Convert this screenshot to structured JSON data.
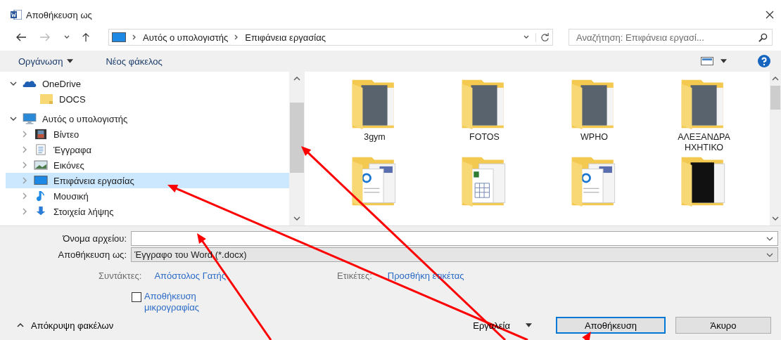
{
  "window": {
    "title": "Αποθήκευση ως"
  },
  "address": {
    "path": [
      "Αυτός ο υπολογιστής",
      "Επιφάνεια εργασίας"
    ]
  },
  "search": {
    "placeholder": "Αναζήτηση: Επιφάνεια εργασί..."
  },
  "toolbar": {
    "organize": "Οργάνωση",
    "new_folder": "Νέος φάκελος"
  },
  "nav_tree": [
    {
      "label": "OneDrive",
      "kind": "cloud",
      "expanded": true,
      "selected": false,
      "children": [
        {
          "label": "DOCS",
          "kind": "folder",
          "selected": false
        }
      ]
    },
    {
      "label": "Αυτός ο υπολογιστής",
      "kind": "computer",
      "expanded": true,
      "selected": false,
      "children": [
        {
          "label": "Βίντεο",
          "kind": "video",
          "expanded": false,
          "selected": false
        },
        {
          "label": "Έγγραφα",
          "kind": "documents",
          "expanded": false,
          "selected": false
        },
        {
          "label": "Εικόνες",
          "kind": "pictures",
          "expanded": false,
          "selected": false
        },
        {
          "label": "Επιφάνεια εργασίας",
          "kind": "desktop",
          "expanded": false,
          "selected": true
        },
        {
          "label": "Μουσική",
          "kind": "music",
          "expanded": false,
          "selected": false
        },
        {
          "label": "Στοιχεία λήψης",
          "kind": "downloads",
          "expanded": false,
          "selected": false
        }
      ]
    }
  ],
  "files": [
    {
      "kind": "photos",
      "label": "3gym"
    },
    {
      "kind": "photos",
      "label": "FOTOS"
    },
    {
      "kind": "photos",
      "label": "WPHO"
    },
    {
      "kind": "photos",
      "label": "ΑΛΕΞΑΝΔΡΑ ΗΧΗΤΙΚΟ"
    },
    {
      "kind": "pdf"
    },
    {
      "kind": "sheet"
    },
    {
      "kind": "pdf"
    },
    {
      "kind": "dark"
    }
  ],
  "form": {
    "filename_label": "Όνομα αρχείου:",
    "type_label": "Αποθήκευση ως:",
    "type_value": "Έγγραφο του Word (*.docx)",
    "authors_label": "Συντάκτες:",
    "authors_value": "Απόστολος Γατής",
    "tags_label": "Ετικέτες:",
    "tags_value": "Προσθήκη ετικέτας",
    "thumbnail": {
      "label": "Αποθήκευση μικρογραφίας",
      "checked": false
    }
  },
  "footer": {
    "hide_folders": "Απόκρυψη φακέλων",
    "tools": "Εργαλεία",
    "save": "Αποθήκευση",
    "cancel": "Άκυρο"
  }
}
